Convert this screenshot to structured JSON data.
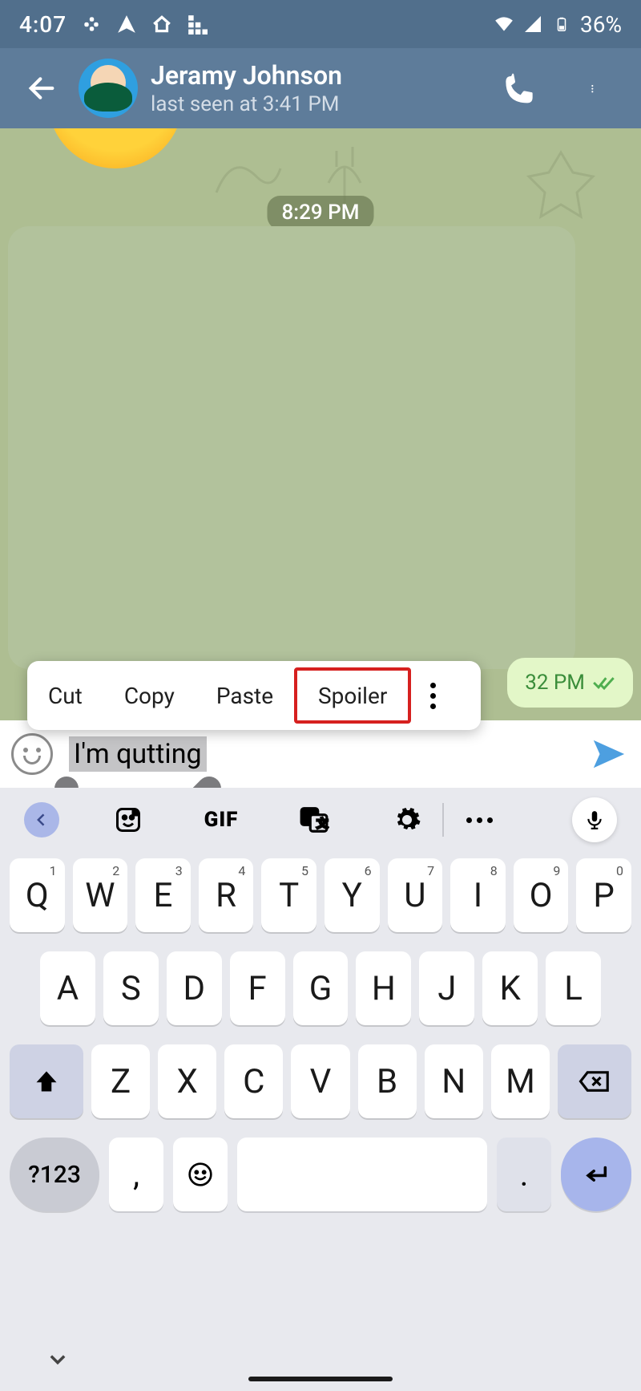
{
  "status": {
    "time": "4:07",
    "battery": "36%"
  },
  "header": {
    "name": "Jeramy Johnson",
    "sub": "last seen at 3:41 PM"
  },
  "chat": {
    "time_badge": "8:29 PM",
    "bubble_time": "32 PM"
  },
  "context_menu": {
    "cut": "Cut",
    "copy": "Copy",
    "paste": "Paste",
    "spoiler": "Spoiler"
  },
  "input": {
    "text": "I'm qutting"
  },
  "keyboard": {
    "gif": "GIF",
    "row1": [
      {
        "k": "Q",
        "s": "1"
      },
      {
        "k": "W",
        "s": "2"
      },
      {
        "k": "E",
        "s": "3"
      },
      {
        "k": "R",
        "s": "4"
      },
      {
        "k": "T",
        "s": "5"
      },
      {
        "k": "Y",
        "s": "6"
      },
      {
        "k": "U",
        "s": "7"
      },
      {
        "k": "I",
        "s": "8"
      },
      {
        "k": "O",
        "s": "9"
      },
      {
        "k": "P",
        "s": "0"
      }
    ],
    "row2": [
      "A",
      "S",
      "D",
      "F",
      "G",
      "H",
      "J",
      "K",
      "L"
    ],
    "row3": [
      "Z",
      "X",
      "C",
      "V",
      "B",
      "N",
      "M"
    ],
    "numkey": "?123",
    "comma": ",",
    "dot": "."
  }
}
